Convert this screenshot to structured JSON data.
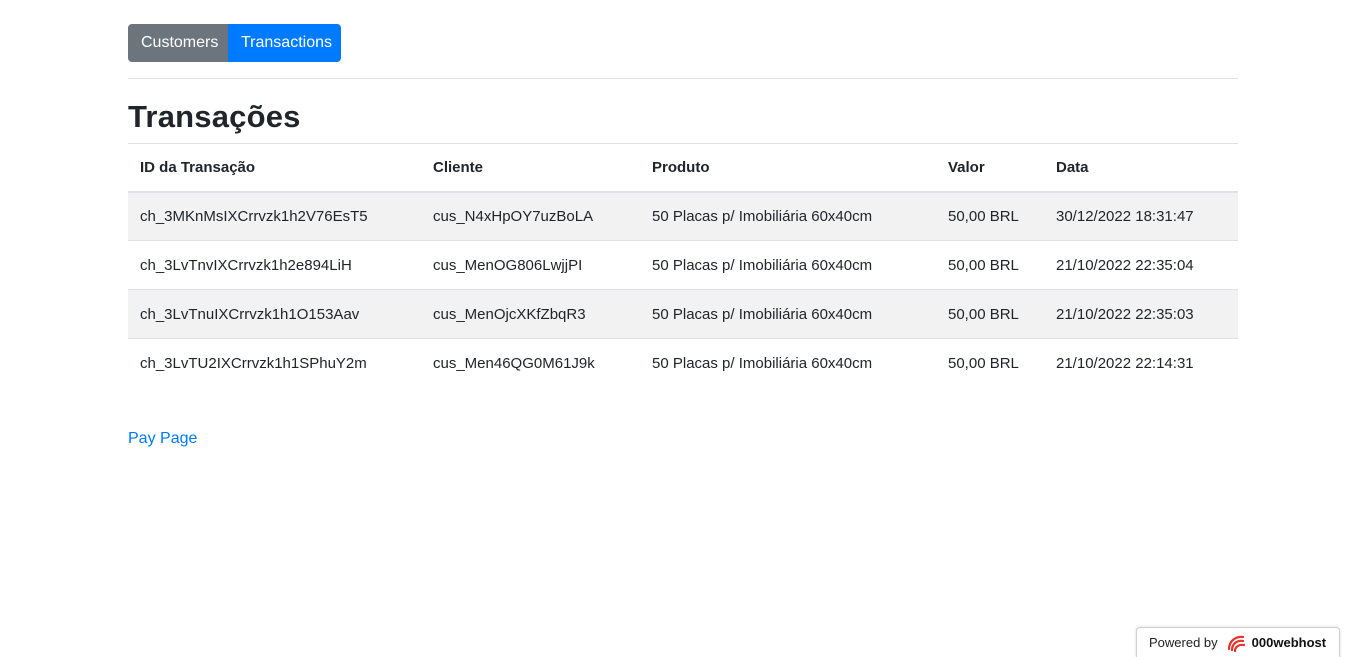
{
  "nav": {
    "customers_label": "Customers",
    "transactions_label": "Transactions"
  },
  "page": {
    "title": "Transações"
  },
  "table": {
    "headers": {
      "id": "ID da Transação",
      "cliente": "Cliente",
      "produto": "Produto",
      "valor": "Valor",
      "data": "Data"
    },
    "rows": [
      {
        "id": "ch_3MKnMsIXCrrvzk1h2V76EsT5",
        "cliente": "cus_N4xHpOY7uzBoLA",
        "produto": "50 Placas p/ Imobiliária 60x40cm",
        "valor": "50,00 BRL",
        "data": "30/12/2022 18:31:47"
      },
      {
        "id": "ch_3LvTnvIXCrrvzk1h2e894LiH",
        "cliente": "cus_MenOG806LwjjPI",
        "produto": "50 Placas p/ Imobiliária 60x40cm",
        "valor": "50,00 BRL",
        "data": "21/10/2022 22:35:04"
      },
      {
        "id": "ch_3LvTnuIXCrrvzk1h1O153Aav",
        "cliente": "cus_MenOjcXKfZbqR3",
        "produto": "50 Placas p/ Imobiliária 60x40cm",
        "valor": "50,00 BRL",
        "data": "21/10/2022 22:35:03"
      },
      {
        "id": "ch_3LvTU2IXCrrvzk1h1SPhuY2m",
        "cliente": "cus_Men46QG0M61J9k",
        "produto": "50 Placas p/ Imobiliária 60x40cm",
        "valor": "50,00 BRL",
        "data": "21/10/2022 22:14:31"
      }
    ]
  },
  "links": {
    "pay_page": "Pay Page"
  },
  "footer": {
    "powered_label": "Powered by",
    "brand": "000webhost",
    "brand_icon": "000webhost-logo-icon"
  },
  "colors": {
    "primary": "#007bff",
    "secondary": "#6c757d",
    "stripe": "#f2f2f2"
  }
}
